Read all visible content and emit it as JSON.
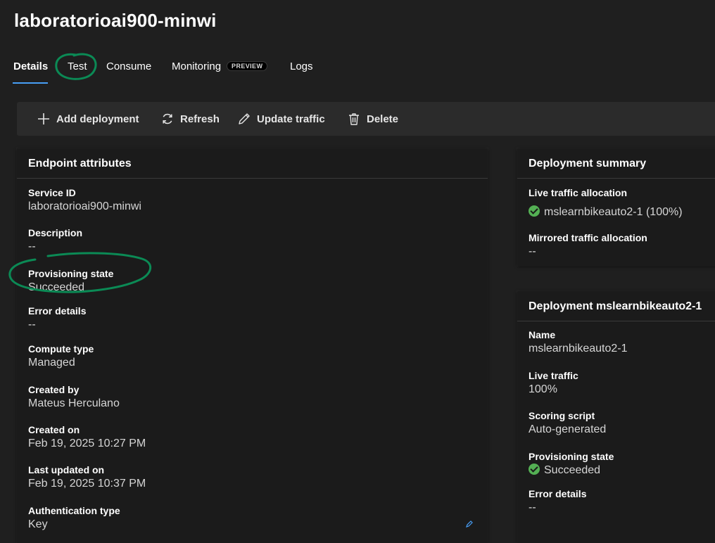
{
  "page": {
    "title": "laboratorioai900-minwi"
  },
  "tabs": [
    {
      "label": "Details",
      "active": true
    },
    {
      "label": "Test"
    },
    {
      "label": "Consume"
    },
    {
      "label": "Monitoring",
      "badge": "PREVIEW"
    },
    {
      "label": "Logs"
    }
  ],
  "toolbar": {
    "add_deployment": "Add deployment",
    "refresh": "Refresh",
    "update_traffic": "Update traffic",
    "delete": "Delete"
  },
  "endpoint": {
    "header": "Endpoint attributes",
    "fields": [
      {
        "label": "Service ID",
        "value": "laboratorioai900-minwi"
      },
      {
        "label": "Description",
        "value": "--"
      },
      {
        "label": "Provisioning state",
        "value": "Succeeded"
      },
      {
        "label": "Error details",
        "value": "--"
      },
      {
        "label": "Compute type",
        "value": "Managed"
      },
      {
        "label": "Created by",
        "value": "Mateus Herculano"
      },
      {
        "label": "Created on",
        "value": "Feb 19, 2025 10:27 PM"
      },
      {
        "label": "Last updated on",
        "value": "Feb 19, 2025 10:37 PM"
      },
      {
        "label": "Authentication type",
        "value": "Key"
      }
    ]
  },
  "summary": {
    "header": "Deployment summary",
    "live_label": "Live traffic allocation",
    "live_value": "mslearnbikeauto2-1 (100%)",
    "mirrored_label": "Mirrored traffic allocation",
    "mirrored_value": "--"
  },
  "deployment": {
    "header": "Deployment mslearnbikeauto2-1",
    "fields": [
      {
        "label": "Name",
        "value": "mslearnbikeauto2-1"
      },
      {
        "label": "Live traffic",
        "value": "100%"
      },
      {
        "label": "Scoring script",
        "value": "Auto-generated"
      },
      {
        "label": "Provisioning state",
        "value": "Succeeded"
      },
      {
        "label": "Error details",
        "value": "--"
      }
    ]
  },
  "colors": {
    "background": "#1f1f1f",
    "accent": "#479ef5",
    "success": "#54b054",
    "annotation": "#0b8a55"
  }
}
